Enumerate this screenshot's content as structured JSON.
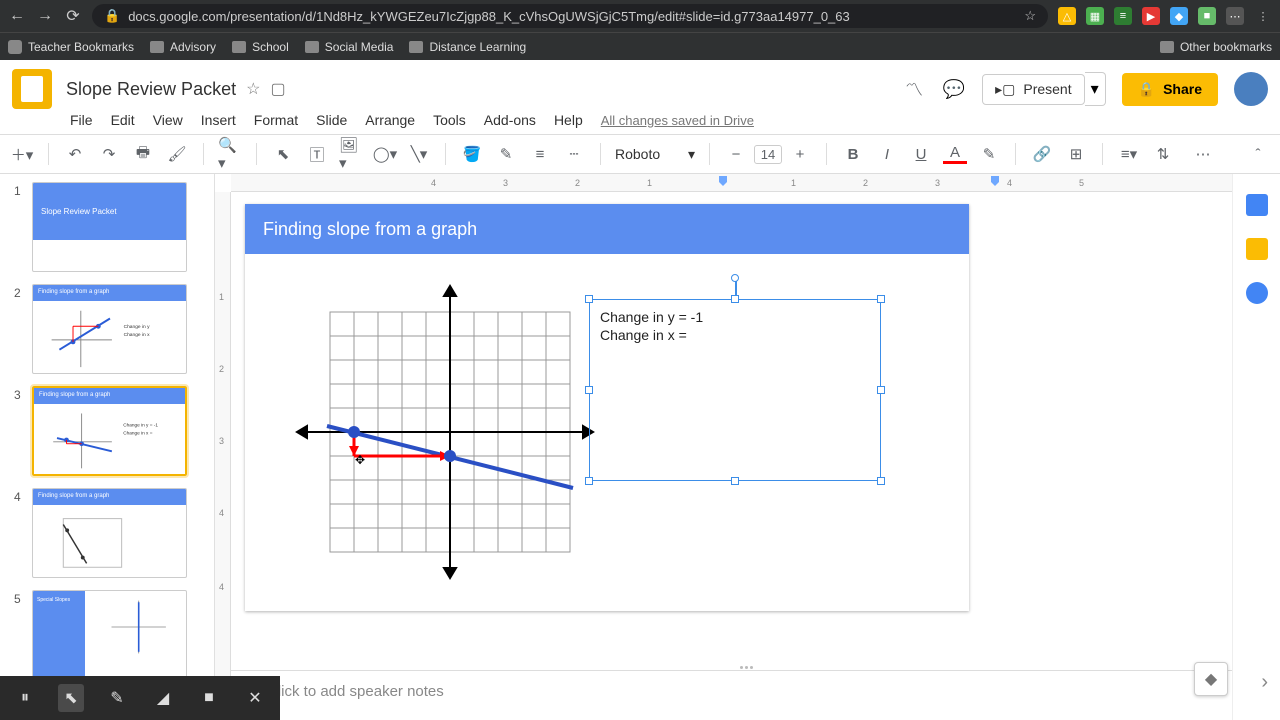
{
  "browser": {
    "url": "docs.google.com/presentation/d/1Nd8Hz_kYWGEZeu7IcZjgp88_K_cVhsOgUWSjGjC5Tmg/edit#slide=id.g773aa14977_0_63"
  },
  "bookmarks": {
    "b1": "Teacher Bookmarks",
    "b2": "Advisory",
    "b3": "School",
    "b4": "Social Media",
    "b5": "Distance Learning",
    "other": "Other bookmarks"
  },
  "doc": {
    "title": "Slope Review Packet",
    "saved": "All changes saved in Drive"
  },
  "menu": {
    "file": "File",
    "edit": "Edit",
    "view": "View",
    "insert": "Insert",
    "format": "Format",
    "slide": "Slide",
    "arrange": "Arrange",
    "tools": "Tools",
    "addons": "Add-ons",
    "help": "Help"
  },
  "header_buttons": {
    "present": "Present",
    "share": "Share"
  },
  "toolbar": {
    "font": "Roboto",
    "size": "14"
  },
  "filmstrip": {
    "n1": "1",
    "n2": "2",
    "n3": "3",
    "n4": "4",
    "n5": "5",
    "t1_title": "Slope Review Packet",
    "strip": "Finding slope from a graph",
    "strip5": "Special Slopes"
  },
  "slide": {
    "title": "Finding slope from a graph",
    "line1": "Change in y = -1",
    "line2": "Change in x = "
  },
  "notes": {
    "placeholder": "Click to add speaker notes"
  },
  "ruler_h": {
    "m4": "4",
    "m3": "3",
    "m2": "2",
    "m1": "1",
    "p1": "1",
    "p2": "2",
    "p3": "3",
    "p4": "4",
    "p5": "5"
  },
  "ruler_v": {
    "v1": "1",
    "v2": "2",
    "v3": "3",
    "v4": "4"
  }
}
